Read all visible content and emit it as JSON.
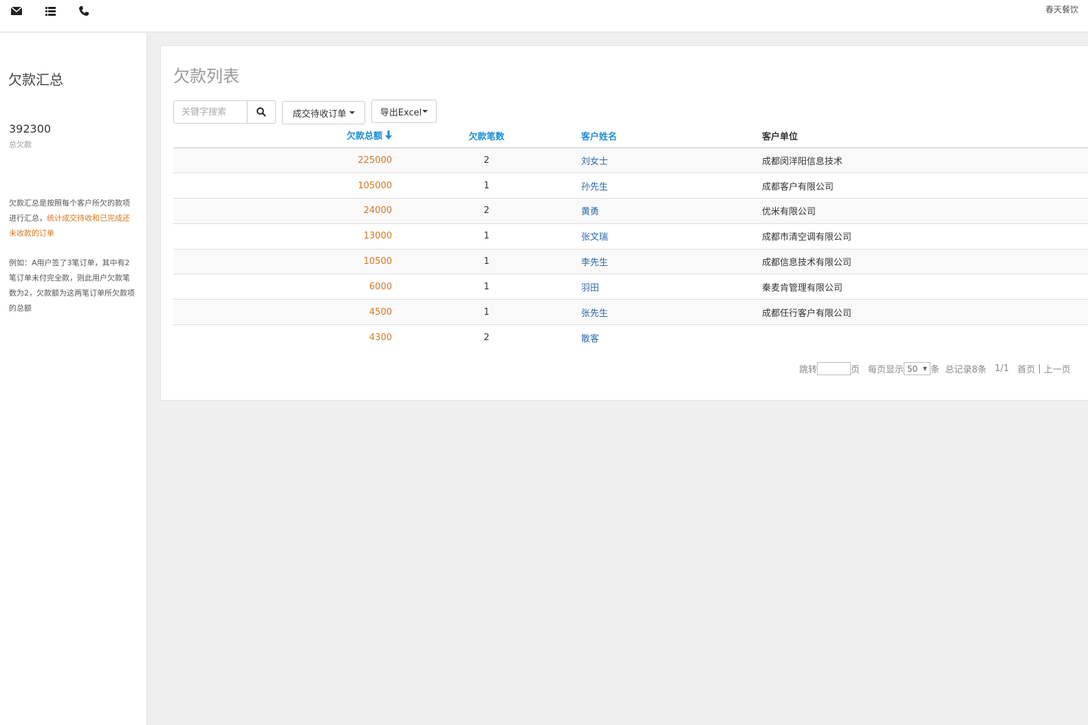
{
  "topbar": {
    "icons": [
      "mail-icon",
      "list-icon",
      "phone-icon"
    ],
    "brand": "春天餐饮"
  },
  "sidebar": {
    "title": "欠款汇总",
    "total_value": "392300",
    "total_label": "总欠款",
    "note1_prefix": "欠款汇总是按照每个客户所欠的款项进行汇总，",
    "note1_highlight": "统计成交待收和已完成还未收款的订单",
    "note2": "例如：A用户签了3笔订单，其中有2笔订单未付完全款，则此用户欠款笔数为2，欠款额为这两笔订单所欠款项的总额"
  },
  "panel": {
    "title": "欠款列表",
    "search_placeholder": "关键字搜索",
    "filter_label": "成交待收订单",
    "export_label": "导出Excel"
  },
  "table": {
    "headers": {
      "amount": "欠款总额",
      "count": "欠款笔数",
      "name": "客户姓名",
      "company": "客户单位"
    },
    "rows": [
      {
        "amount": "225000",
        "count": "2",
        "name": "刘女士",
        "company": "成都闵洋阳信息技术"
      },
      {
        "amount": "105000",
        "count": "1",
        "name": "孙先生",
        "company": "成都客户有限公司"
      },
      {
        "amount": "24000",
        "count": "2",
        "name": "黄勇",
        "company": "优米有限公司"
      },
      {
        "amount": "13000",
        "count": "1",
        "name": "张文瑞",
        "company": "成都市清空调有限公司"
      },
      {
        "amount": "10500",
        "count": "1",
        "name": "李先生",
        "company": "成都信息技术有限公司"
      },
      {
        "amount": "6000",
        "count": "1",
        "name": "羽田",
        "company": "秦麦肯管理有限公司"
      },
      {
        "amount": "4500",
        "count": "1",
        "name": "张先生",
        "company": "成都任行客户有限公司"
      },
      {
        "amount": "4300",
        "count": "2",
        "name": "散客",
        "company": ""
      }
    ]
  },
  "pager": {
    "jump_label": "跳转",
    "page_unit": "页",
    "per_page_label": "每页显示",
    "per_page_value": "50",
    "per_page_unit": "条",
    "total_records": "总记录8条",
    "page_info": "1/1",
    "first": "首页",
    "separator": "|",
    "prev": "上一页"
  },
  "colors": {
    "accent_blue": "#1a8ed8",
    "amount_orange": "#d9761e",
    "name_link": "#2a6aa8"
  }
}
